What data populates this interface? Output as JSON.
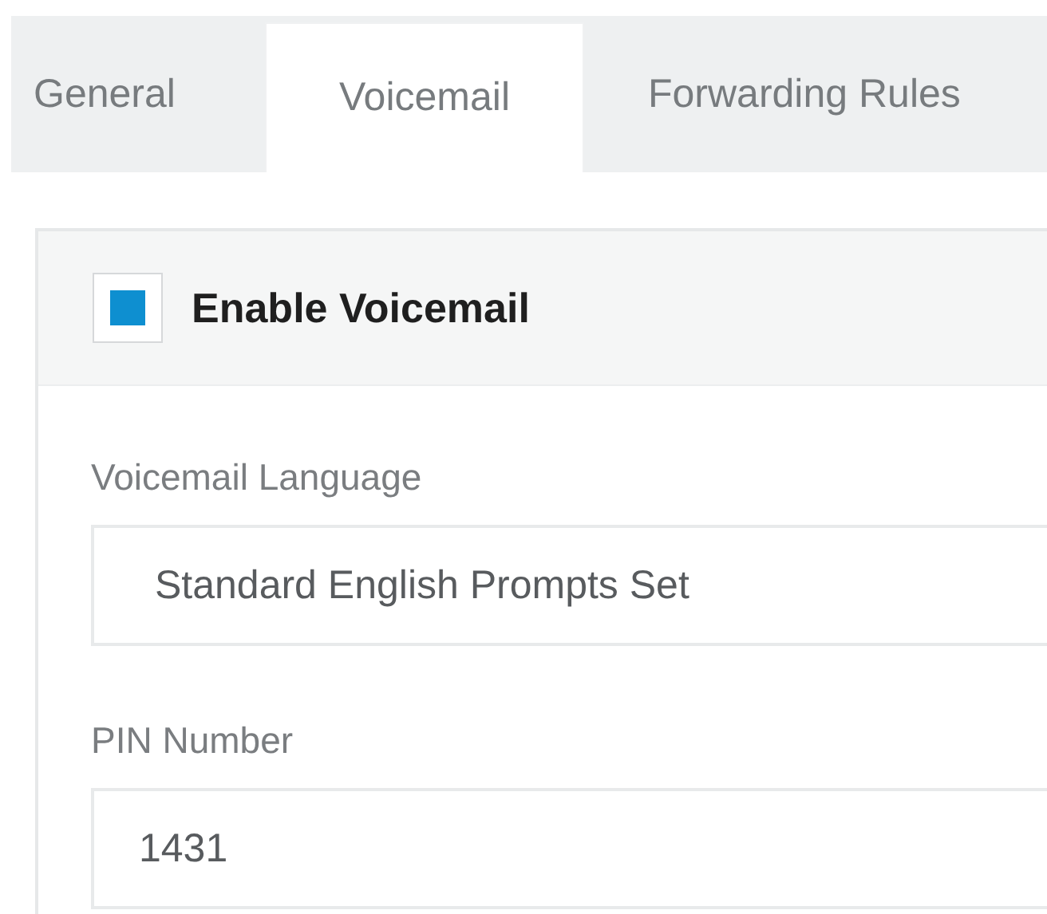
{
  "tabs": [
    {
      "label": "General",
      "selected": false
    },
    {
      "label": "Voicemail",
      "selected": true
    },
    {
      "label": "Forwarding Rules",
      "selected": false
    }
  ],
  "panel": {
    "enable_voicemail": {
      "label": "Enable Voicemail",
      "checked": true
    },
    "fields": [
      {
        "kind": "select",
        "label": "Voicemail Language",
        "value": "Standard English Prompts Set"
      },
      {
        "kind": "input",
        "label": "PIN Number",
        "value": "1431"
      }
    ]
  }
}
